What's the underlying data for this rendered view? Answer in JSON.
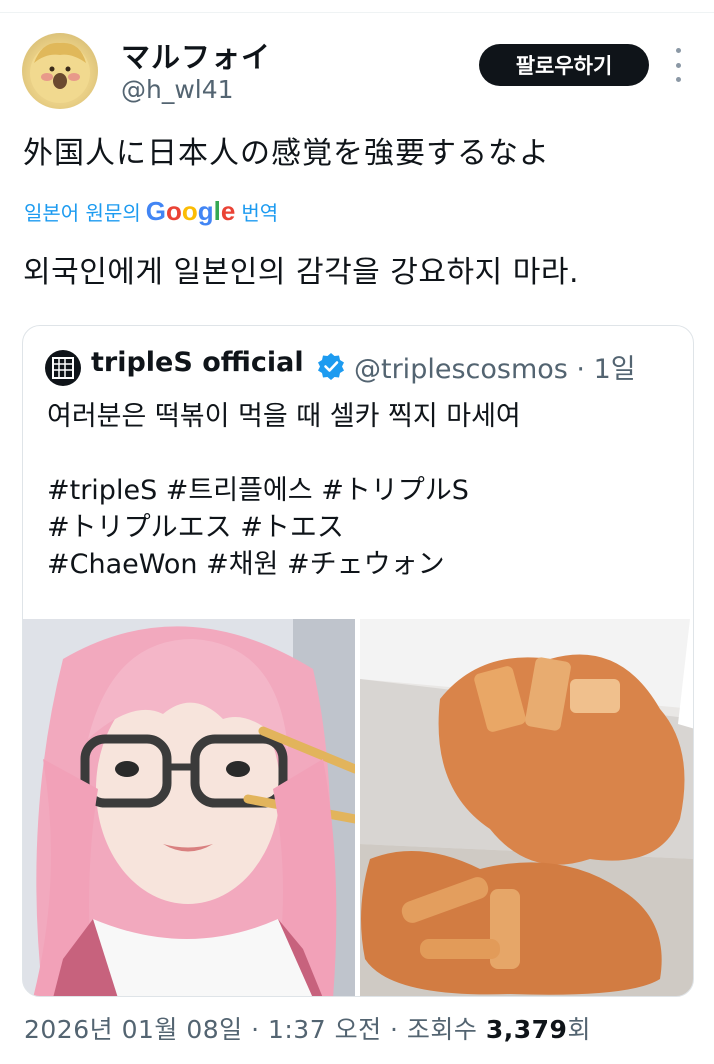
{
  "author": {
    "display_name": "マルフォイ",
    "handle": "@h_wl41",
    "follow_label": "팔로우하기"
  },
  "tweet": {
    "text": "外国人に日本人の感覚を強要するなよ",
    "translate_prefix": "일본어 원문의",
    "translate_brand": "Google",
    "translate_suffix": "번역",
    "translated_text": "외국인에게 일본인의 감각을 강요하지 마라."
  },
  "quote": {
    "name": "tripleS official",
    "handle_time": "@triplescosmos · 1일",
    "lines": [
      "여러분은 떡볶이 먹을 때 셀카 찍지 마세여",
      "",
      "#tripleS #트리플에스 #トリプルS",
      "#トリプルエス #トエス",
      "#ChaeWon #채원 #チェウォン"
    ]
  },
  "meta": {
    "timestamp": "2026년 01월 08일 · 1:37 오전 · 조회수",
    "views": "3,379",
    "views_suffix": "회"
  },
  "colors": {
    "link": "#1d9bf0",
    "follow_bg": "#0f1419",
    "secondary_text": "#536471",
    "verified": "#1d9bf0"
  },
  "icons": [
    "more-vertical-icon",
    "verified-badge-icon",
    "triples-logo-icon"
  ]
}
